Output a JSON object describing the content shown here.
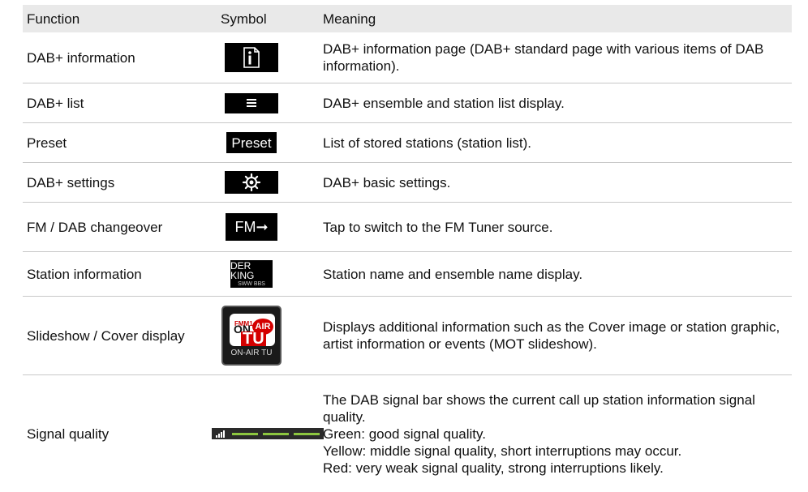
{
  "header": {
    "function": "Function",
    "symbol": "Symbol",
    "meaning": "Meaning"
  },
  "rows": [
    {
      "function": "DAB+ information",
      "symbol_icon": "info-page-icon",
      "meaning": "DAB+ information page (DAB+ standard page with various items of DAB information)."
    },
    {
      "function": "DAB+ list",
      "symbol_icon": "list-icon",
      "meaning": "DAB+ ensemble and station list display."
    },
    {
      "function": "Preset",
      "symbol_text": "Preset",
      "meaning": "List of stored stations (station list)."
    },
    {
      "function": "DAB+ settings",
      "symbol_icon": "gear-icon",
      "meaning": "DAB+ basic settings."
    },
    {
      "function": "FM / DAB changeover",
      "symbol_text": "FM➞",
      "meaning": "Tap to switch to the FM Tuner source."
    },
    {
      "function": "Station information",
      "symbol_text": "DER KING",
      "symbol_sub": "SWW BBS",
      "meaning": "Station name and ensemble name display."
    },
    {
      "function": "Slideshow / Cover display",
      "symbol_logo_top": "FMM1",
      "symbol_logo_on": "ON",
      "symbol_logo_air": "AIR",
      "symbol_logo_tu": "TU",
      "symbol_caption": "ON-AIR TU",
      "meaning": "Displays additional information such as the Cover image or station graphic, artist information or events (MOT slideshow)."
    },
    {
      "function": "Signal quality",
      "symbol_icon": "signal-bar-icon",
      "meaning_lines": [
        "The DAB signal bar shows the current call up station information signal quality.",
        "Green: good signal quality.",
        "Yellow: middle signal quality, short interruptions may occur.",
        "Red: very weak signal quality, strong interruptions likely."
      ]
    }
  ],
  "colors": {
    "header_bg": "#e9e9e9",
    "rule": "#c8c8c8",
    "signal_green": "#8cc63f"
  }
}
